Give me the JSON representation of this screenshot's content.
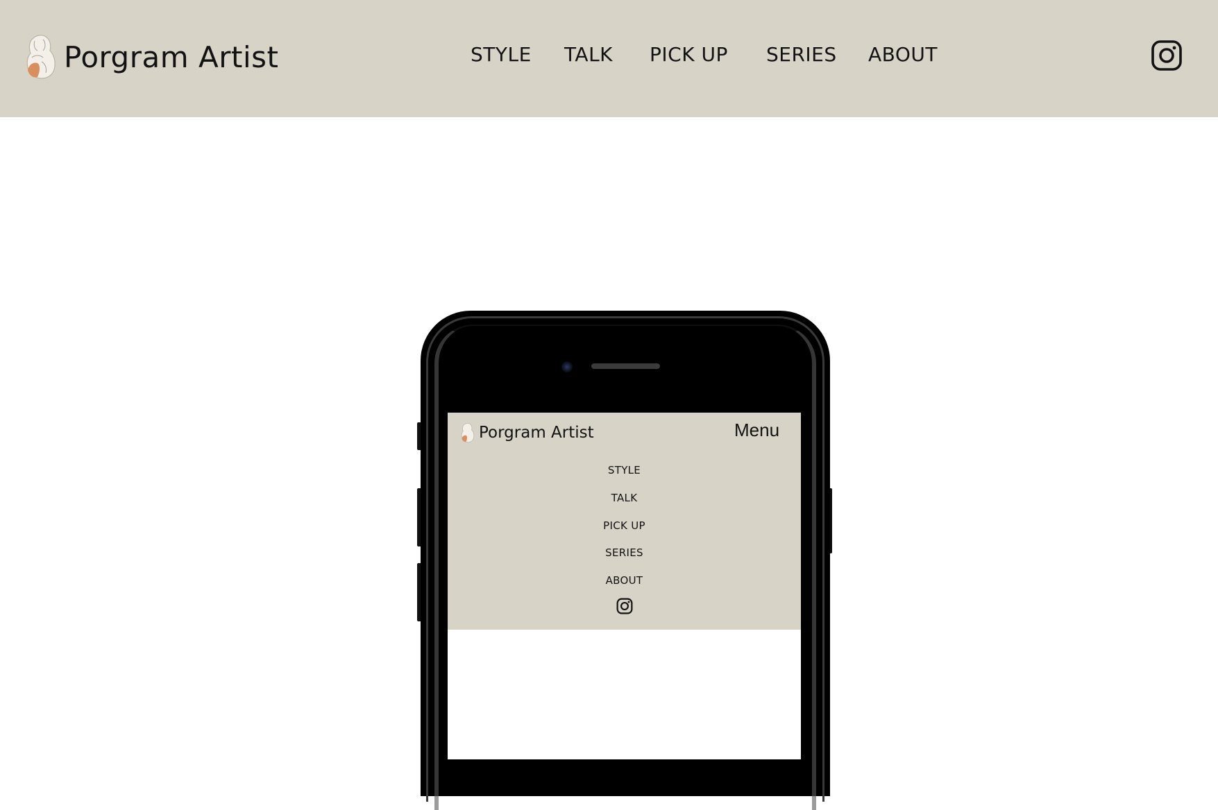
{
  "header": {
    "brand_name": "Porgram Artist",
    "background_color": "#d7d3c7",
    "logo_icon": "artist-sketch-logo",
    "social_icon": "instagram-icon"
  },
  "nav": {
    "items": [
      {
        "label": "STYLE"
      },
      {
        "label": "TALK"
      },
      {
        "label": "PICK UP"
      },
      {
        "label": "SERIES"
      },
      {
        "label": "ABOUT"
      }
    ]
  },
  "mobile_preview": {
    "brand_name": "Porgram Artist",
    "menu_label": "Menu",
    "nav_items": [
      {
        "label": "STYLE"
      },
      {
        "label": "TALK"
      },
      {
        "label": "PICK UP"
      },
      {
        "label": "SERIES"
      },
      {
        "label": "ABOUT"
      }
    ],
    "social_icon": "instagram-icon"
  }
}
